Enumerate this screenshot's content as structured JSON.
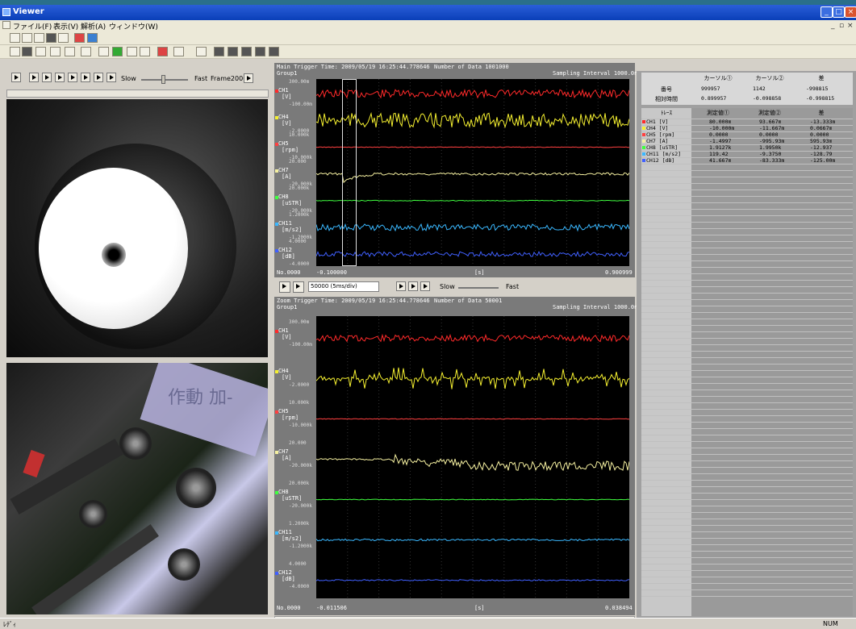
{
  "window": {
    "title": "Viewer"
  },
  "menu": [
    "ファイル(F)",
    "表示(V)",
    "解析(A)",
    "ウィンドウ(W)"
  ],
  "video": {
    "speed_slow": "Slow",
    "speed_fast": "Fast",
    "frame_label": "Frame2000",
    "plate_text": "作動 加-"
  },
  "main_chart": {
    "trigger": "Main Trigger Time: 2009/05/19 16:25:44.778646",
    "group": "Group1",
    "num_data": "Number of Data 1001000",
    "interval": "Sampling Interval  1000.0ns",
    "x_start": "-0.100000",
    "x_unit": "[s]",
    "x_end": "0.900999",
    "no": "No.0000"
  },
  "zoom_chart": {
    "trigger": "Zoom Trigger Time: 2009/05/19 16:25:44.778646",
    "group": "Group1",
    "num_data": "Number of Data 50001",
    "interval": "Sampling Interval  1000.0ns",
    "x_start": "-0.011506",
    "x_unit": "[s]",
    "x_end": "0.038494",
    "no": "No.0000"
  },
  "zoom_ctl": {
    "div_value": "50000",
    "div_label": "(5ms/div)",
    "slow": "Slow",
    "fast": "Fast"
  },
  "channels": [
    {
      "name": "CH1",
      "unit": "[V]",
      "color": "#ff2a2a",
      "top": "300.00m",
      "bottom": "-100.00m"
    },
    {
      "name": "CH4",
      "unit": "[V]",
      "color": "#f5f030",
      "top": "",
      "bottom": "-2.0000"
    },
    {
      "name": "CH5",
      "unit": "[rpm]",
      "color": "#ff4040",
      "top": "10.000k",
      "bottom": "-10.000k"
    },
    {
      "name": "CH7",
      "unit": "[A]",
      "color": "#f5f0a0",
      "top": "20.000",
      "bottom": "-20.000k"
    },
    {
      "name": "CH8",
      "unit": "[uSTR]",
      "color": "#40ff40",
      "top": "20.000k",
      "bottom": "-20.000k"
    },
    {
      "name": "CH11",
      "unit": "[m/s2]",
      "color": "#3ab8ff",
      "top": "1.2000k",
      "bottom": "-1.2000k"
    },
    {
      "name": "CH12",
      "unit": "[dB]",
      "color": "#4060ff",
      "top": "4.0000",
      "bottom": "-4.0000"
    }
  ],
  "right_table": {
    "cursor_headers": [
      "カーソル①",
      "カーソル②",
      "差"
    ],
    "row_labels": [
      "番号",
      "相対時間"
    ],
    "number_vals": [
      "999957",
      "1142",
      "-998815"
    ],
    "time_vals": [
      "0.899957",
      "-0.098858",
      "-0.998815"
    ],
    "grid_headers": [
      "ﾄﾚｰｽ",
      "測定値①",
      "測定値②",
      "差"
    ],
    "rows": [
      {
        "ch": "CH1 [V]",
        "color": "#ff2a2a",
        "v1": "80.000m",
        "v2": "93.667m",
        "d": "-13.333m"
      },
      {
        "ch": "CH4 [V]",
        "color": "#f5f030",
        "v1": "-10.000m",
        "v2": "-11.667m",
        "d": "0.0667m"
      },
      {
        "ch": "CH5 [rpm]",
        "color": "#ff4040",
        "v1": "0.0000",
        "v2": "0.0000",
        "d": "0.0000"
      },
      {
        "ch": "CH7 [A]",
        "color": "#f5f0a0",
        "v1": "-1.4997",
        "v2": "-995.93m",
        "d": "595.93m"
      },
      {
        "ch": "CH8 [uSTR]",
        "color": "#40ff40",
        "v1": "1.9127k",
        "v2": "1.9950k",
        "d": "-12.937"
      },
      {
        "ch": "CH11 [m/s2]",
        "color": "#3ab8ff",
        "v1": "119.42",
        "v2": "-9.3750",
        "d": "-128.79"
      },
      {
        "ch": "CH12 [dB]",
        "color": "#4060ff",
        "v1": "41.667m",
        "v2": "-83.333m",
        "d": "-125.00m"
      }
    ]
  },
  "status": {
    "left": "ﾚﾃﾞｨ",
    "right": "NUM"
  }
}
